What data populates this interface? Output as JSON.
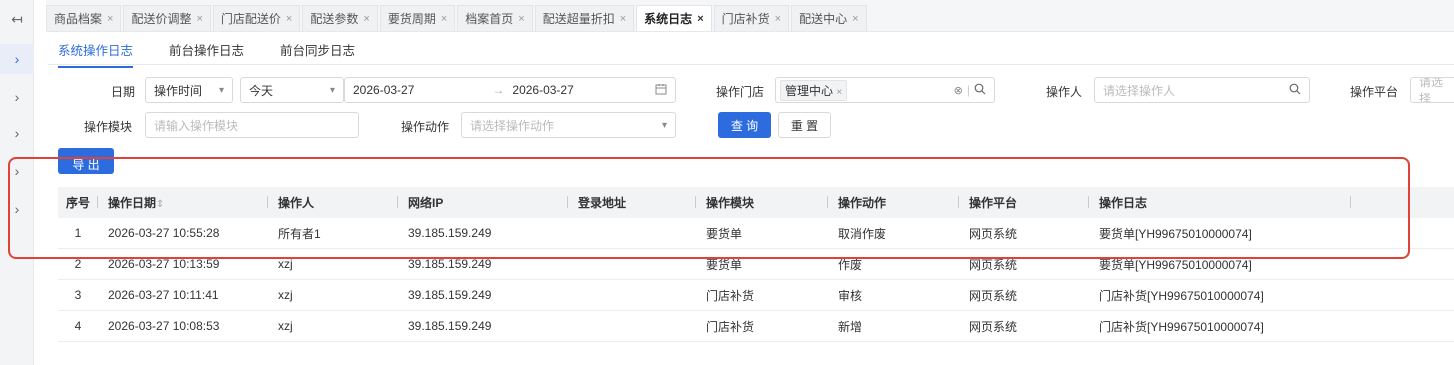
{
  "left_rail": {
    "collapse_icon": "↤",
    "expand_icon": "›"
  },
  "tabs": [
    {
      "label": "商品档案",
      "active": false
    },
    {
      "label": "配送价调整",
      "active": false
    },
    {
      "label": "门店配送价",
      "active": false
    },
    {
      "label": "配送参数",
      "active": false
    },
    {
      "label": "要货周期",
      "active": false
    },
    {
      "label": "档案首页",
      "active": false
    },
    {
      "label": "配送超量折扣",
      "active": false
    },
    {
      "label": "系统日志",
      "active": true
    },
    {
      "label": "门店补货",
      "active": false
    },
    {
      "label": "配送中心",
      "active": false
    }
  ],
  "tab_close": "×",
  "subtabs": [
    "系统操作日志",
    "前台操作日志",
    "前台同步日志"
  ],
  "filters": {
    "date_label": "日期",
    "date_type": "操作时间",
    "date_preset": "今天",
    "date_start": "2026-03-27",
    "date_end": "2026-03-27",
    "date_arrow": "→",
    "store_label": "操作门店",
    "store_tag": "管理中心",
    "operator_label": "操作人",
    "operator_placeholder": "请选择操作人",
    "platform_label": "操作平台",
    "platform_placeholder": "请选择",
    "module_label": "操作模块",
    "module_placeholder": "请输入操作模块",
    "action_label": "操作动作",
    "action_placeholder": "请选择操作动作",
    "query_button": "查 询",
    "reset_button": "重 置",
    "export_button": "导 出"
  },
  "table": {
    "headers": [
      "序号",
      "操作日期",
      "操作人",
      "网络IP",
      "登录地址",
      "操作模块",
      "操作动作",
      "操作平台",
      "操作日志"
    ],
    "rows": [
      [
        "1",
        "2026-03-27 10:55:28",
        "所有者1",
        "39.185.159.249",
        "",
        "要货单",
        "取消作废",
        "网页系统",
        "要货单[YH99675010000074]"
      ],
      [
        "2",
        "2026-03-27 10:13:59",
        "xzj",
        "39.185.159.249",
        "",
        "要货单",
        "作废",
        "网页系统",
        "要货单[YH99675010000074]"
      ],
      [
        "3",
        "2026-03-27 10:11:41",
        "xzj",
        "39.185.159.249",
        "",
        "门店补货",
        "审核",
        "网页系统",
        "门店补货[YH99675010000074]"
      ],
      [
        "4",
        "2026-03-27 10:08:53",
        "xzj",
        "39.185.159.249",
        "",
        "门店补货",
        "新增",
        "网页系统",
        "门店补货[YH99675010000074]"
      ]
    ]
  },
  "colors": {
    "primary": "#2d6cdf",
    "highlight": "#e0413a",
    "header_bg": "#f2f3f5"
  }
}
